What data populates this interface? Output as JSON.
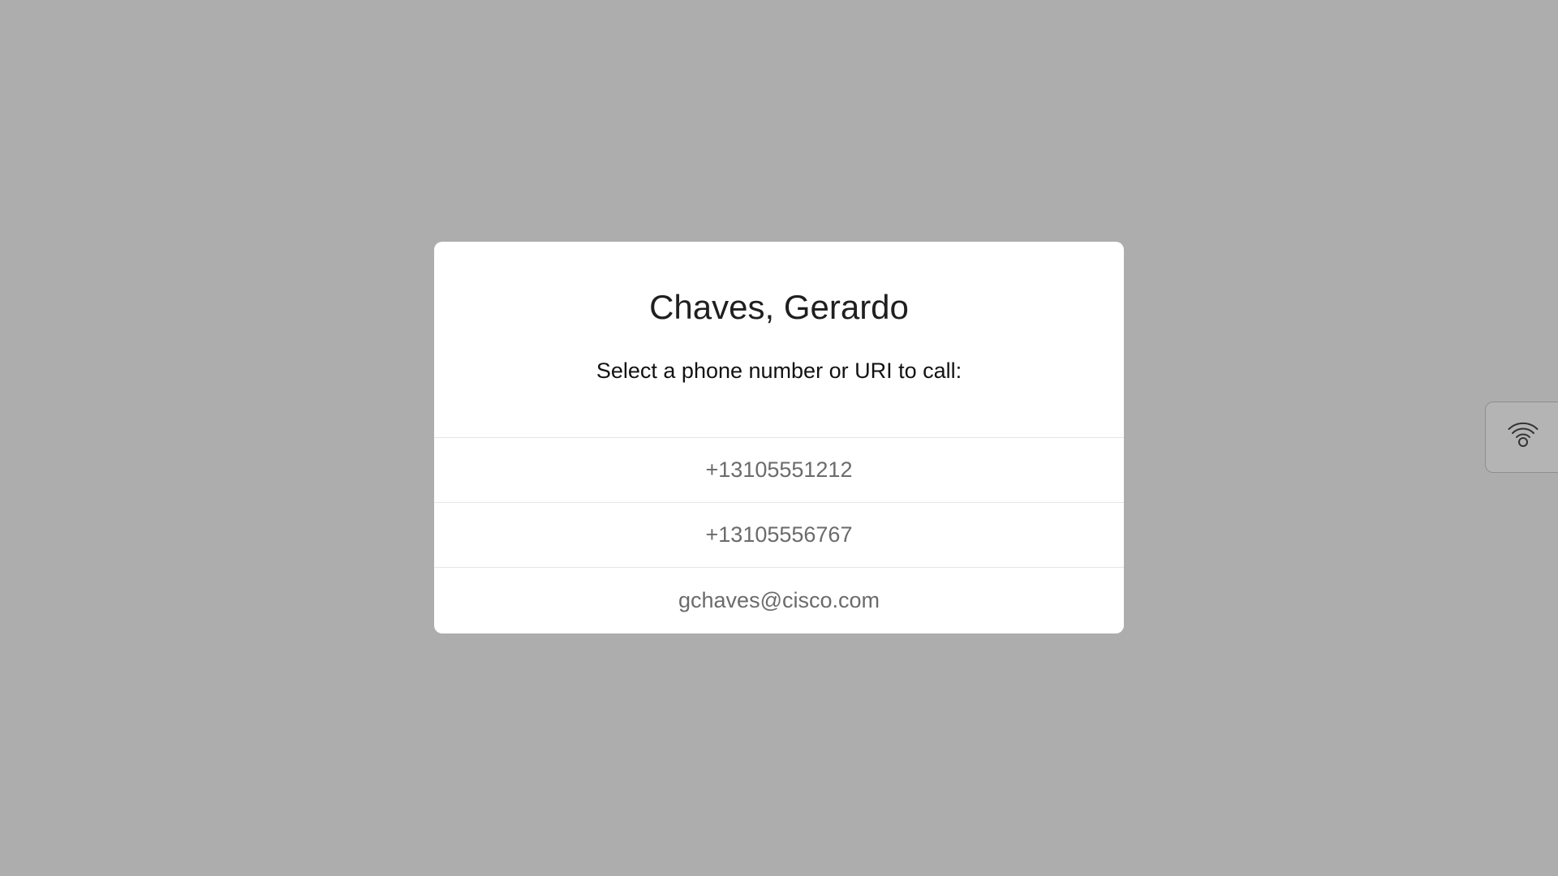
{
  "dialog": {
    "title": "Chaves, Gerardo",
    "subtitle": "Select a phone number or URI to call:",
    "options": [
      {
        "label": "+13105551212"
      },
      {
        "label": "+13105556767"
      },
      {
        "label": "gchaves@cisco.com"
      }
    ]
  },
  "side_tab": {
    "icon": "proximity-icon"
  },
  "colors": {
    "backdrop": "#adadad",
    "dialog_background": "#ffffff",
    "option_text": "#6b6b6b"
  }
}
